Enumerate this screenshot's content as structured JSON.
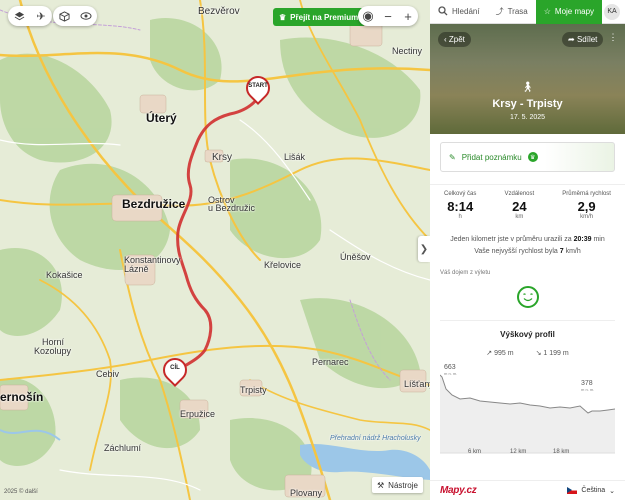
{
  "map": {
    "places": [
      {
        "name": "Bezvěrov",
        "cls": "mid"
      },
      {
        "name": "Nectiny",
        "cls": ""
      },
      {
        "name": "Úterý",
        "cls": "big"
      },
      {
        "name": "Krsy",
        "cls": "mid"
      },
      {
        "name": "Lišák",
        "cls": ""
      },
      {
        "name": "Bezdružice",
        "cls": "big"
      },
      {
        "name": "Ostrov",
        "cls": ""
      },
      {
        "name": "u Bezdružic",
        "cls": ""
      },
      {
        "name": "Konstantinovy",
        "cls": ""
      },
      {
        "name": "Lázně",
        "cls": ""
      },
      {
        "name": "Kokašice",
        "cls": ""
      },
      {
        "name": "Křelovice",
        "cls": ""
      },
      {
        "name": "Úněšov",
        "cls": ""
      },
      {
        "name": "Horní",
        "cls": ""
      },
      {
        "name": "Kozolupy",
        "cls": ""
      },
      {
        "name": "Cebiv",
        "cls": ""
      },
      {
        "name": "Trpisty",
        "cls": ""
      },
      {
        "name": "Erpužice",
        "cls": ""
      },
      {
        "name": "Pernarec",
        "cls": ""
      },
      {
        "name": "Líšťany",
        "cls": ""
      },
      {
        "name": "ernošín",
        "cls": "big"
      },
      {
        "name": "Záchlumí",
        "cls": ""
      },
      {
        "name": "Přehradní nádrž Hracholusky",
        "cls": "water"
      },
      {
        "name": "Plovany",
        "cls": ""
      }
    ],
    "start_label": "START",
    "end_label": "CÍL",
    "premium_label": "Přejít na Premium",
    "tools_label": "Nástroje",
    "scale_text": "2025 © další",
    "expand_icon": "❯",
    "zoom_in": "+",
    "zoom_out": "−"
  },
  "nav": {
    "search": "Hledání",
    "route": "Trasa",
    "mymaps": "Moje mapy",
    "user": "KA"
  },
  "trip": {
    "back": "Zpět",
    "share": "Sdílet",
    "title": "Krsy - Trpisty",
    "date": "17. 5. 2025",
    "add_note": "Přidat poznámku",
    "stats": [
      {
        "label": "Celkový čas",
        "value": "8:14",
        "unit": "h"
      },
      {
        "label": "Vzdálenost",
        "value": "24",
        "unit": "km"
      },
      {
        "label": "Průměrná rychlost",
        "value": "2,9",
        "unit": "km/h"
      }
    ],
    "pace_prefix": "Jeden kilometr jste v průměru urazili za",
    "pace_value": "20:39",
    "pace_unit": "min",
    "speed_prefix": "Vaše nejvyšší rychlost byla",
    "speed_value": "7",
    "speed_unit": "km/h",
    "feeling_label": "Váš dojem z výletu"
  },
  "profile": {
    "title": "Výškový profil",
    "ascent": "995 m",
    "descent": "1 199 m",
    "max_label": "663",
    "max_unit": "m n. m.",
    "end_label": "378",
    "end_unit": "m n. m.",
    "ticks": [
      "6 km",
      "12 km",
      "18 km"
    ]
  },
  "footer": {
    "logo": "Mapy.cz",
    "language": "Čeština"
  },
  "colors": {
    "accent": "#2aa52a",
    "route": "#d03030"
  }
}
